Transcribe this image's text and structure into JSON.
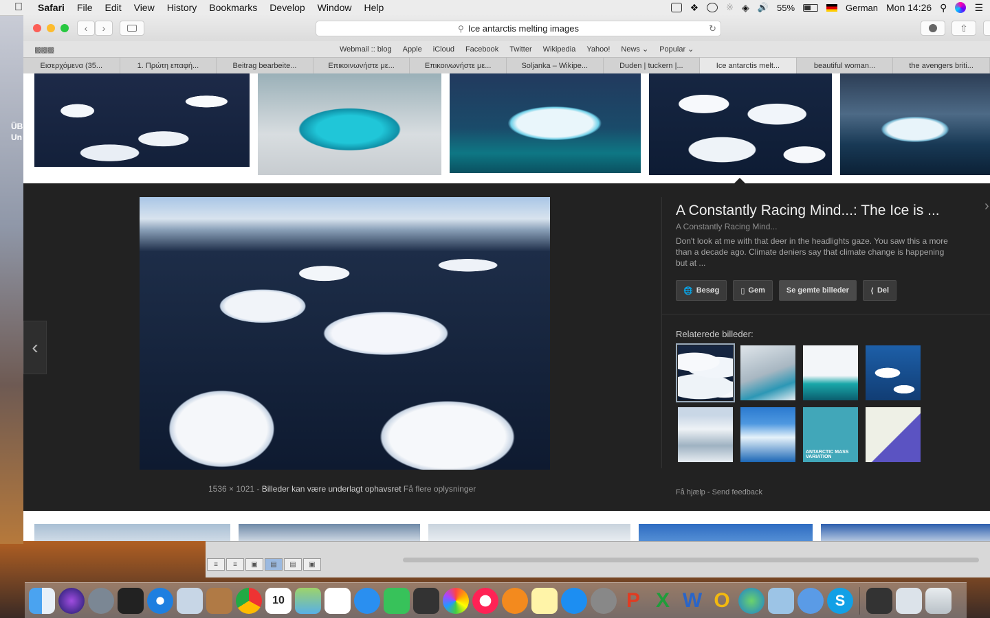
{
  "menubar": {
    "app": "Safari",
    "items": [
      "File",
      "Edit",
      "View",
      "History",
      "Bookmarks",
      "Develop",
      "Window",
      "Help"
    ],
    "battery": "55%",
    "input_language": "German",
    "clock": "Mon 14:26"
  },
  "desktop": {
    "label_line1": "ÜB",
    "label_line2": "Un"
  },
  "browser": {
    "address": "Ice antarctis melting images",
    "favorites": [
      "Webmail :: blog",
      "Apple",
      "iCloud",
      "Facebook",
      "Twitter",
      "Wikipedia",
      "Yahoo!",
      "News ⌄",
      "Popular ⌄"
    ],
    "tabs": [
      "Εισερχόμενα (35...",
      "1. Πρώτη επαφή...",
      "Beitrag bearbeite...",
      "Επικοινωνήστε με...",
      "Επικοινωνήστε με...",
      "Soljanka – Wikipe...",
      "Duden | tuckern |...",
      "Ice antarctis melt...",
      "beautiful woman...",
      "the avengers briti..."
    ]
  },
  "preview": {
    "title": "A Constantly Racing Mind...: The Ice is ...",
    "site": "A Constantly Racing Mind...",
    "description": "Don't look at me with that deer in the headlights gaze. You saw this a more than a decade ago. Climate deniers say that climate change is happening but at ...",
    "actions": {
      "visit": "Besøg",
      "save": "Gem",
      "saved": "Se gemte billeder",
      "share": "Del"
    },
    "related_label": "Relaterede billeder:",
    "dimensions": "1536 × 1021",
    "rights": "Billeder kan være underlagt ophavsret",
    "more_info": "Få flere oplysninger",
    "help": "Få hjælp",
    "feedback": "Send feedback",
    "related_chart_text": "ANTARCTIC MASS VARIATION"
  }
}
